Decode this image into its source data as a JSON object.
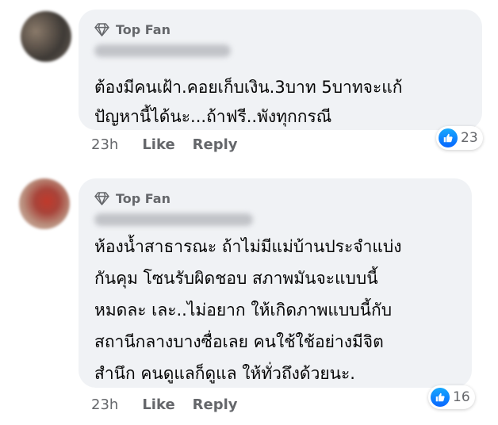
{
  "comments": [
    {
      "badge": "Top Fan",
      "lines": [
        "ต้องมีคนเฝ้า.คอยเก็บเงิน.3บาท 5บาทจะแก้",
        "ปัญหานี้ได้นะ...ถ้าฟรี..พังทุกกรณี"
      ],
      "time": "23h",
      "like_label": "Like",
      "reply_label": "Reply",
      "reaction_count": "23"
    },
    {
      "badge": "Top Fan",
      "lines": [
        "ห้องน้ำสาธารณะ ถ้าไม่มีแม่บ้านประจำแบ่ง",
        "กันคุม โซนรับผิดชอบ สภาพมันจะแบบนี้",
        "หมดละ เละ..ไม่อยาก ให้เกิดภาพแบบนี้กับ",
        "สถานีกลางบางซื่อเลย คนใช้ใช้อย่างมีจิต",
        "สำนึก คนดูแลก็ดูแล ให้ทั่วถึงด้วยนะ."
      ],
      "time": "23h",
      "like_label": "Like",
      "reply_label": "Reply",
      "reaction_count": "16"
    }
  ],
  "icons": {
    "badge": "diamond-icon",
    "reaction": "thumbs-up-icon"
  },
  "colors": {
    "bubble": "#f0f2f5",
    "secondary_text": "#65676b",
    "like_blue": "#0866ff"
  }
}
